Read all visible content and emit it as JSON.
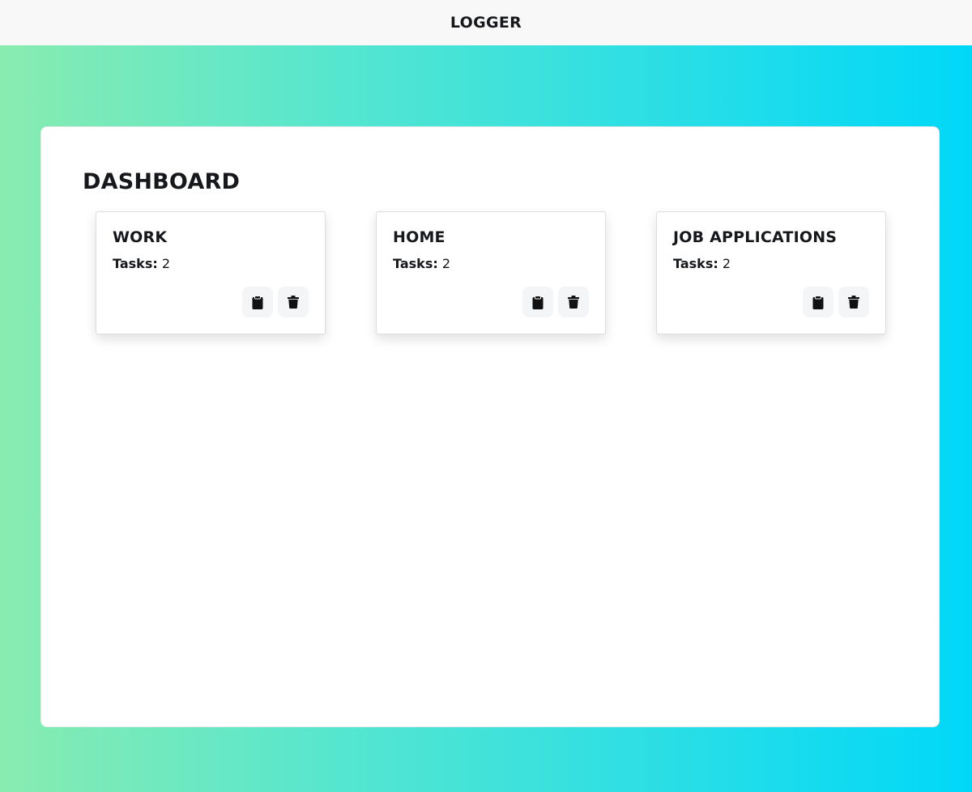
{
  "header": {
    "brand": "LOGGER"
  },
  "dashboard": {
    "title": "DASHBOARD",
    "cards": [
      {
        "title": "WORK",
        "tasks_label": "Tasks:",
        "tasks_count": "2",
        "actions": [
          "clipboard-icon",
          "trash-icon"
        ]
      },
      {
        "title": "HOME",
        "tasks_label": "Tasks:",
        "tasks_count": "2",
        "actions": [
          "clipboard-icon",
          "trash-icon"
        ]
      },
      {
        "title": "JOB APPLICATIONS",
        "tasks_label": "Tasks:",
        "tasks_count": "2",
        "actions": [
          "clipboard-icon",
          "trash-icon"
        ]
      }
    ]
  },
  "colors": {
    "gradient_start": "#88ecb0",
    "gradient_end": "#00d8f8",
    "header_bg": "#f8f8f8",
    "text": "#17181c",
    "icon_button_bg": "#f4f5f7"
  }
}
